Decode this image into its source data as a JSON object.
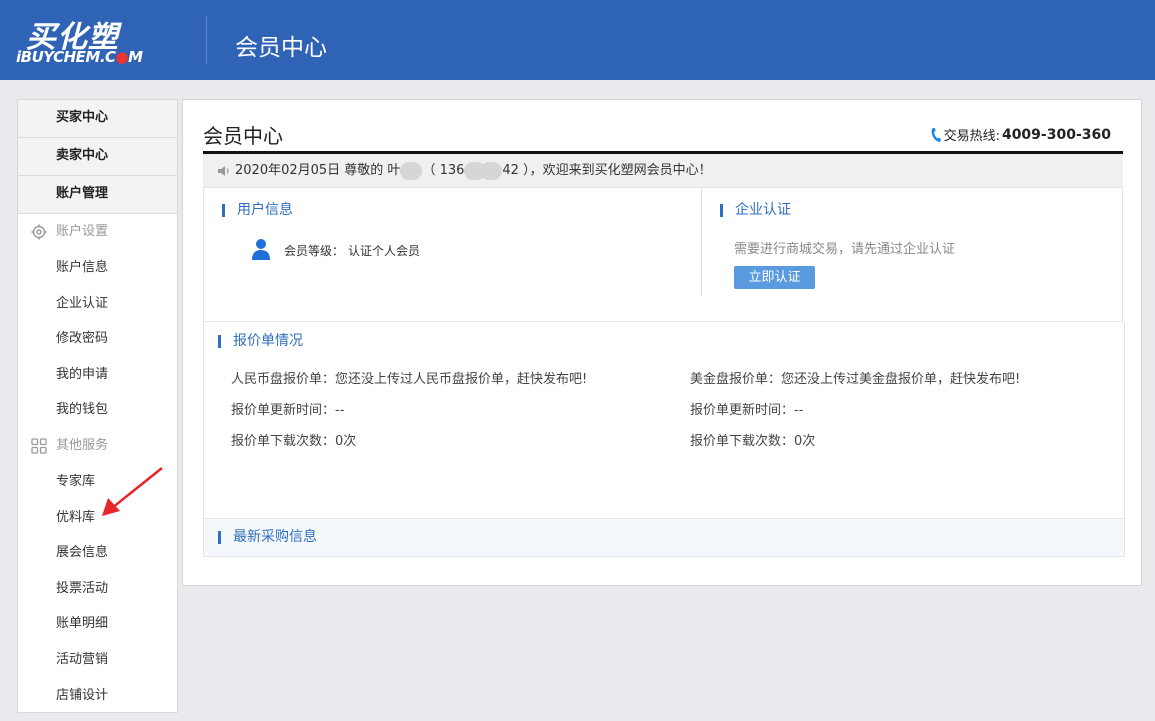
{
  "header": {
    "logo_cn": "买化塑",
    "logo_en_a": "iBUYCHEM.C",
    "logo_en_dot": "●",
    "logo_en_b": "M",
    "title": "会员中心"
  },
  "sidebar": {
    "heads": [
      "买家中心",
      "卖家中心",
      "账户管理"
    ],
    "group_account": "账户设置",
    "account_items": [
      "账户信息",
      "企业认证",
      "修改密码",
      "我的申请",
      "我的钱包"
    ],
    "group_other": "其他服务",
    "other_items": [
      "专家库",
      "优料库",
      "展会信息",
      "投票活动",
      "账单明细",
      "活动营销",
      "店铺设计"
    ]
  },
  "main": {
    "title": "会员中心",
    "hotline_label": "交易热线:",
    "hotline_number": "4009-300-360",
    "welcome_a": "2020年02月05日 尊敬的 叶",
    "welcome_b": "（ 136",
    "welcome_c": "42 ），欢迎来到买化塑网会员中心！",
    "user_info_title": "用户信息",
    "member_level_label": "会员等级：",
    "member_level_value": "认证个人会员",
    "cert_title": "企业认证",
    "cert_tip": "需要进行商城交易，请先通过企业认证",
    "cert_button": "立即认证",
    "quote_title": "报价单情况",
    "rmb_quote": "人民币盘报价单：您还没上传过人民币盘报价单，赶快发布吧!",
    "rmb_update": "报价单更新时间：--",
    "rmb_downloads": "报价单下载次数：0次",
    "usd_quote": "美金盘报价单：您还没上传过美金盘报价单，赶快发布吧!",
    "usd_update": "报价单更新时间：--",
    "usd_downloads": "报价单下载次数：0次",
    "latest_title": "最新采购信息"
  },
  "colors": {
    "brand_blue": "#2f63b6",
    "link_blue": "#2f6fbf",
    "button_blue": "#5a9be0",
    "arrow_red": "#e8262a"
  }
}
